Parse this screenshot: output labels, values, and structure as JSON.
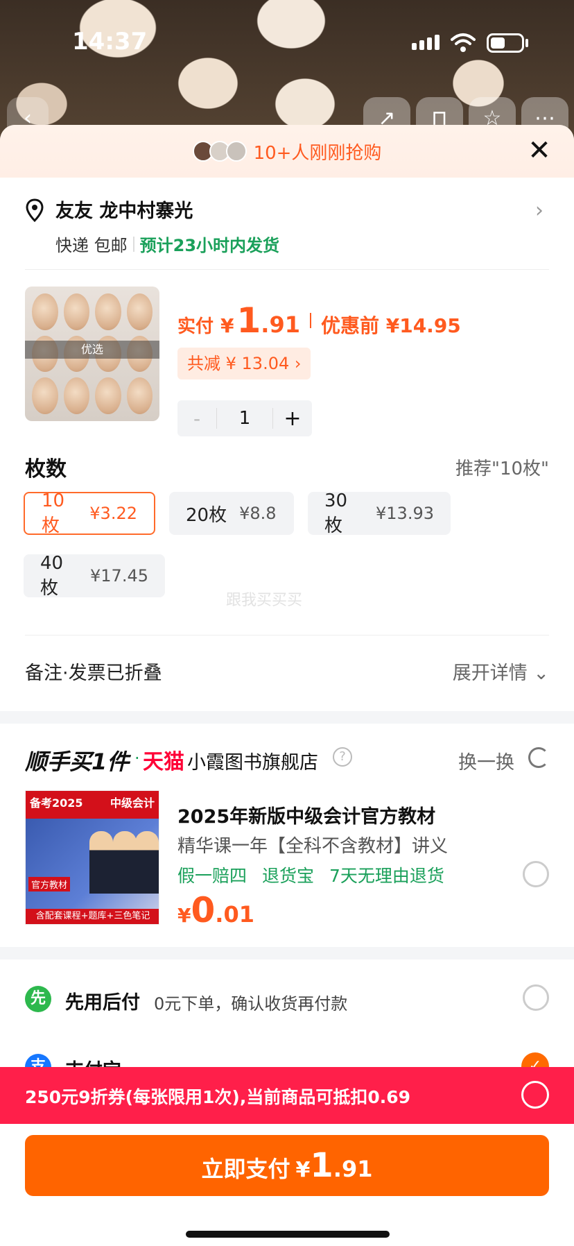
{
  "status_bar": {
    "time": "14:37"
  },
  "banner": {
    "text": "10+人刚刚抢购",
    "close_glyph": "✕"
  },
  "address": {
    "name": "友友 龙中村寨光",
    "shipping": "快递 包邮",
    "eta": "预计23小时内发货"
  },
  "product": {
    "image_label": "优选",
    "price_label": "实付",
    "currency": "¥",
    "price_int": "1",
    "price_dec": ".91",
    "original": "优惠前 ¥14.95",
    "discount": "共减 ¥ 13.04 ›",
    "quantity": "1",
    "minus": "-",
    "plus": "+"
  },
  "spec": {
    "title": "枚数",
    "recommend": "推荐\"10枚\"",
    "options": [
      {
        "label": "10枚",
        "price": "¥3.22",
        "selected": true
      },
      {
        "label": "20枚",
        "price": "¥8.8",
        "selected": false
      },
      {
        "label": "30枚",
        "price": "¥13.93",
        "selected": false
      },
      {
        "label": "40枚",
        "price": "¥17.45",
        "selected": false
      }
    ],
    "watermark": "跟我买买买"
  },
  "remark": {
    "left": "备注·发票已折叠",
    "right": "展开详情 ⌄"
  },
  "bundle": {
    "brand": "顺手买1件",
    "dot": "·",
    "tmall": "天猫",
    "store": "小霞图书旗舰店",
    "help": "?",
    "swap": "换一换",
    "image_top_left": "备考2025",
    "image_top_right": "中级会计",
    "image_tag": "官方教材",
    "image_bottom": "含配套课程+题库+三色笔记",
    "title": "2025年新版中级会计官方教材",
    "subtitle": "精华课一年【全科不含教材】讲义",
    "tags": [
      "假一赔四",
      "退货宝",
      "7天无理由退货"
    ],
    "currency": "¥",
    "price_int": "0",
    "price_dec": ".01"
  },
  "payment": {
    "methods": [
      {
        "name": "先用后付",
        "desc": "0元下单，确认收货再付款",
        "icon": "先",
        "color": "#2db84d",
        "selected": false
      },
      {
        "name": "支付宝",
        "desc": "",
        "icon": "支",
        "color": "#1677ff",
        "selected": true
      }
    ]
  },
  "coupon": {
    "text": "250元9折券(每张限用1次),当前商品可抵扣0.69"
  },
  "pay_button": {
    "label": "立即支付",
    "currency": "¥",
    "int": "1",
    "dec": ".91"
  },
  "colors": {
    "accent": "#ff5a1f",
    "button": "#ff6400",
    "coupon_bar": "#ff1f4a",
    "green": "#1aa05a"
  }
}
